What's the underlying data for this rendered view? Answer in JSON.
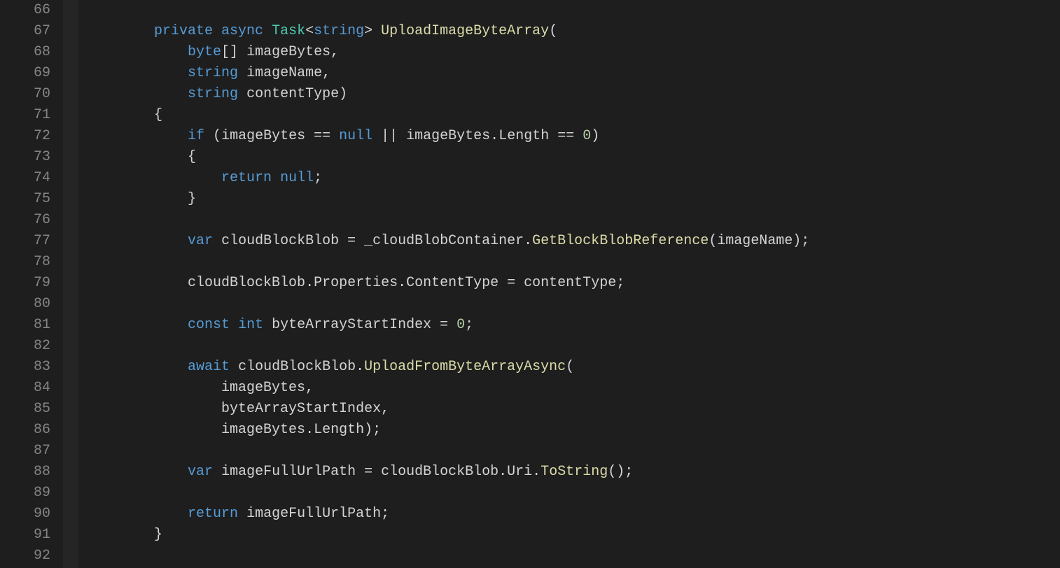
{
  "gutter": {
    "start": 66,
    "end": 92
  },
  "colors": {
    "background": "#1e1e1e",
    "gutterText": "#858585",
    "plain": "#d4d4d4",
    "keyword": "#569cd6",
    "type": "#4ec9b0",
    "method": "#dcdcaa",
    "number": "#b5cea8"
  },
  "code": {
    "lines": [
      {
        "n": 66,
        "tokens": []
      },
      {
        "n": 67,
        "tokens": [
          {
            "t": "        ",
            "c": "pln"
          },
          {
            "t": "private",
            "c": "kw"
          },
          {
            "t": " ",
            "c": "pln"
          },
          {
            "t": "async",
            "c": "kw"
          },
          {
            "t": " ",
            "c": "pln"
          },
          {
            "t": "Task",
            "c": "typ"
          },
          {
            "t": "<",
            "c": "pun"
          },
          {
            "t": "string",
            "c": "kw"
          },
          {
            "t": "> ",
            "c": "pun"
          },
          {
            "t": "UploadImageByteArray",
            "c": "mth"
          },
          {
            "t": "(",
            "c": "pun"
          }
        ]
      },
      {
        "n": 68,
        "tokens": [
          {
            "t": "            ",
            "c": "pln"
          },
          {
            "t": "byte",
            "c": "kw"
          },
          {
            "t": "[] ",
            "c": "pun"
          },
          {
            "t": "imageBytes",
            "c": "pln"
          },
          {
            "t": ",",
            "c": "pun"
          }
        ]
      },
      {
        "n": 69,
        "tokens": [
          {
            "t": "            ",
            "c": "pln"
          },
          {
            "t": "string",
            "c": "kw"
          },
          {
            "t": " ",
            "c": "pln"
          },
          {
            "t": "imageName",
            "c": "pln"
          },
          {
            "t": ",",
            "c": "pun"
          }
        ]
      },
      {
        "n": 70,
        "tokens": [
          {
            "t": "            ",
            "c": "pln"
          },
          {
            "t": "string",
            "c": "kw"
          },
          {
            "t": " ",
            "c": "pln"
          },
          {
            "t": "contentType",
            "c": "pln"
          },
          {
            "t": ")",
            "c": "pun"
          }
        ]
      },
      {
        "n": 71,
        "tokens": [
          {
            "t": "        {",
            "c": "pun"
          }
        ]
      },
      {
        "n": 72,
        "tokens": [
          {
            "t": "            ",
            "c": "pln"
          },
          {
            "t": "if",
            "c": "kw"
          },
          {
            "t": " (",
            "c": "pun"
          },
          {
            "t": "imageBytes",
            "c": "pln"
          },
          {
            "t": " == ",
            "c": "op"
          },
          {
            "t": "null",
            "c": "kw"
          },
          {
            "t": " || ",
            "c": "op"
          },
          {
            "t": "imageBytes",
            "c": "pln"
          },
          {
            "t": ".",
            "c": "pun"
          },
          {
            "t": "Length",
            "c": "pln"
          },
          {
            "t": " == ",
            "c": "op"
          },
          {
            "t": "0",
            "c": "num"
          },
          {
            "t": ")",
            "c": "pun"
          }
        ]
      },
      {
        "n": 73,
        "tokens": [
          {
            "t": "            {",
            "c": "pun"
          }
        ]
      },
      {
        "n": 74,
        "tokens": [
          {
            "t": "                ",
            "c": "pln"
          },
          {
            "t": "return",
            "c": "kw"
          },
          {
            "t": " ",
            "c": "pln"
          },
          {
            "t": "null",
            "c": "kw"
          },
          {
            "t": ";",
            "c": "pun"
          }
        ]
      },
      {
        "n": 75,
        "tokens": [
          {
            "t": "            }",
            "c": "pun"
          }
        ]
      },
      {
        "n": 76,
        "tokens": []
      },
      {
        "n": 77,
        "tokens": [
          {
            "t": "            ",
            "c": "pln"
          },
          {
            "t": "var",
            "c": "kw"
          },
          {
            "t": " ",
            "c": "pln"
          },
          {
            "t": "cloudBlockBlob",
            "c": "pln"
          },
          {
            "t": " = ",
            "c": "op"
          },
          {
            "t": "_cloudBlobContainer",
            "c": "pln"
          },
          {
            "t": ".",
            "c": "pun"
          },
          {
            "t": "GetBlockBlobReference",
            "c": "mth"
          },
          {
            "t": "(",
            "c": "pun"
          },
          {
            "t": "imageName",
            "c": "pln"
          },
          {
            "t": ");",
            "c": "pun"
          }
        ]
      },
      {
        "n": 78,
        "tokens": []
      },
      {
        "n": 79,
        "tokens": [
          {
            "t": "            ",
            "c": "pln"
          },
          {
            "t": "cloudBlockBlob",
            "c": "pln"
          },
          {
            "t": ".",
            "c": "pun"
          },
          {
            "t": "Properties",
            "c": "pln"
          },
          {
            "t": ".",
            "c": "pun"
          },
          {
            "t": "ContentType",
            "c": "pln"
          },
          {
            "t": " = ",
            "c": "op"
          },
          {
            "t": "contentType",
            "c": "pln"
          },
          {
            "t": ";",
            "c": "pun"
          }
        ]
      },
      {
        "n": 80,
        "tokens": []
      },
      {
        "n": 81,
        "tokens": [
          {
            "t": "            ",
            "c": "pln"
          },
          {
            "t": "const",
            "c": "kw"
          },
          {
            "t": " ",
            "c": "pln"
          },
          {
            "t": "int",
            "c": "kw"
          },
          {
            "t": " ",
            "c": "pln"
          },
          {
            "t": "byteArrayStartIndex",
            "c": "pln"
          },
          {
            "t": " = ",
            "c": "op"
          },
          {
            "t": "0",
            "c": "num"
          },
          {
            "t": ";",
            "c": "pun"
          }
        ]
      },
      {
        "n": 82,
        "tokens": []
      },
      {
        "n": 83,
        "tokens": [
          {
            "t": "            ",
            "c": "pln"
          },
          {
            "t": "await",
            "c": "kw"
          },
          {
            "t": " ",
            "c": "pln"
          },
          {
            "t": "cloudBlockBlob",
            "c": "pln"
          },
          {
            "t": ".",
            "c": "pun"
          },
          {
            "t": "UploadFromByteArrayAsync",
            "c": "mth"
          },
          {
            "t": "(",
            "c": "pun"
          }
        ]
      },
      {
        "n": 84,
        "tokens": [
          {
            "t": "                ",
            "c": "pln"
          },
          {
            "t": "imageBytes",
            "c": "pln"
          },
          {
            "t": ",",
            "c": "pun"
          }
        ]
      },
      {
        "n": 85,
        "tokens": [
          {
            "t": "                ",
            "c": "pln"
          },
          {
            "t": "byteArrayStartIndex",
            "c": "pln"
          },
          {
            "t": ",",
            "c": "pun"
          }
        ]
      },
      {
        "n": 86,
        "tokens": [
          {
            "t": "                ",
            "c": "pln"
          },
          {
            "t": "imageBytes",
            "c": "pln"
          },
          {
            "t": ".",
            "c": "pun"
          },
          {
            "t": "Length",
            "c": "pln"
          },
          {
            "t": ");",
            "c": "pun"
          }
        ]
      },
      {
        "n": 87,
        "tokens": []
      },
      {
        "n": 88,
        "tokens": [
          {
            "t": "            ",
            "c": "pln"
          },
          {
            "t": "var",
            "c": "kw"
          },
          {
            "t": " ",
            "c": "pln"
          },
          {
            "t": "imageFullUrlPath",
            "c": "pln"
          },
          {
            "t": " = ",
            "c": "op"
          },
          {
            "t": "cloudBlockBlob",
            "c": "pln"
          },
          {
            "t": ".",
            "c": "pun"
          },
          {
            "t": "Uri",
            "c": "pln"
          },
          {
            "t": ".",
            "c": "pun"
          },
          {
            "t": "ToString",
            "c": "mth"
          },
          {
            "t": "();",
            "c": "pun"
          }
        ]
      },
      {
        "n": 89,
        "tokens": []
      },
      {
        "n": 90,
        "tokens": [
          {
            "t": "            ",
            "c": "pln"
          },
          {
            "t": "return",
            "c": "kw"
          },
          {
            "t": " ",
            "c": "pln"
          },
          {
            "t": "imageFullUrlPath",
            "c": "pln"
          },
          {
            "t": ";",
            "c": "pun"
          }
        ]
      },
      {
        "n": 91,
        "tokens": [
          {
            "t": "        }",
            "c": "pun"
          }
        ]
      },
      {
        "n": 92,
        "tokens": []
      }
    ]
  }
}
